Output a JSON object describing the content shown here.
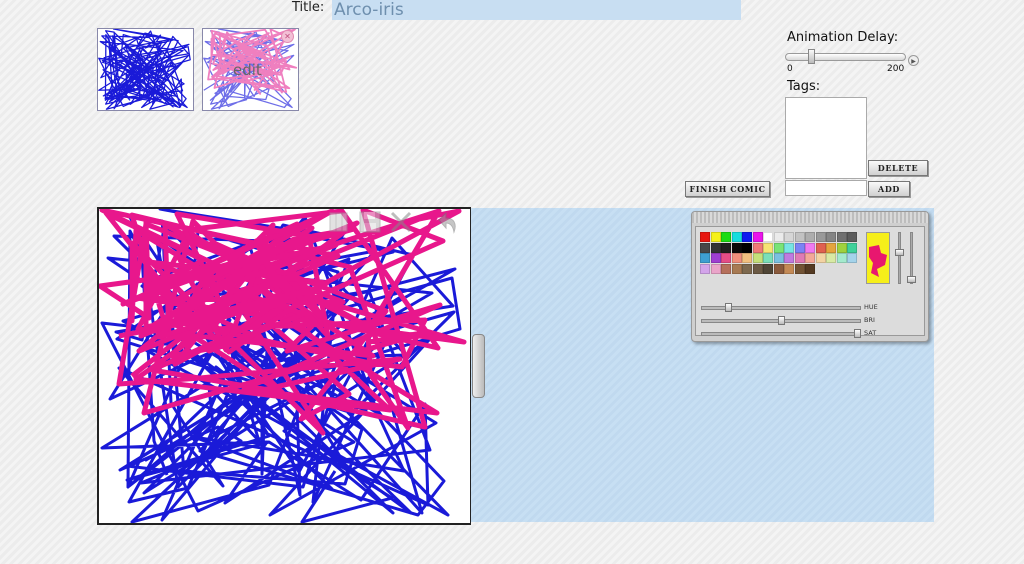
{
  "title": {
    "label": "Title:",
    "value": "Arco-iris"
  },
  "thumbnails": [
    {
      "name": "frame-1",
      "overlay": ""
    },
    {
      "name": "frame-2",
      "overlay": "edit"
    }
  ],
  "animation_delay": {
    "label": "Animation Delay:",
    "min": "0",
    "max": "200",
    "value": 40
  },
  "tags": {
    "label": "Tags:",
    "delete_label": "DELETE",
    "add_label": "ADD"
  },
  "finish_label": "FINISH COMIC",
  "toolbar": {
    "icons": [
      "grid-icon",
      "save-icon",
      "close-icon",
      "undo-icon"
    ]
  },
  "palette": {
    "slider_labels": {
      "hue": "HUE",
      "bri": "BRI",
      "sat": "SAT"
    },
    "swatch_colors": [
      "#e8160f",
      "#f6f11a",
      "#1bdc14",
      "#16ddde",
      "#0f1cf0",
      "#eb14ec",
      "#ffffff",
      "#ebebeb",
      "#d6d6d6",
      "#c2c2c2",
      "#adadad",
      "#999999",
      "#858585",
      "#707070",
      "#5c5c5c",
      "#474747",
      "#333333",
      "#1f1f1f",
      "#0a0a0a",
      "#000000",
      "#f07a78",
      "#f6e474",
      "#79e477",
      "#77e4e4",
      "#7c82f5",
      "#f079f0",
      "#e06050",
      "#e5a53e",
      "#9fd13e",
      "#3fd19a",
      "#3e9fd1",
      "#9f3ed1",
      "#e44d87",
      "#ef8f7c",
      "#f2c07f",
      "#c5e07a",
      "#7ae0b8",
      "#7ac0e0",
      "#c07ae0",
      "#e07ab5",
      "#f4a898",
      "#f3d3a3",
      "#d8eaa4",
      "#a4eacd",
      "#a4d3ea",
      "#d3a4ea",
      "#eaa4c9",
      "#b6705c",
      "#a77a53",
      "#7d694f",
      "#6b5a45",
      "#4f4536",
      "#8a5a3c",
      "#c48a56",
      "#725334",
      "#543a22"
    ],
    "preview_colors": [
      "#f6ef1a",
      "#e8176f"
    ],
    "hue": 0.15,
    "bri": 0.5,
    "sat": 1.0,
    "v1": 0.35,
    "v2": 0.95
  },
  "colors": {
    "accent": "#c8def2",
    "stroke_blue": "#1a1ad8",
    "stroke_pink": "#e8178c"
  }
}
